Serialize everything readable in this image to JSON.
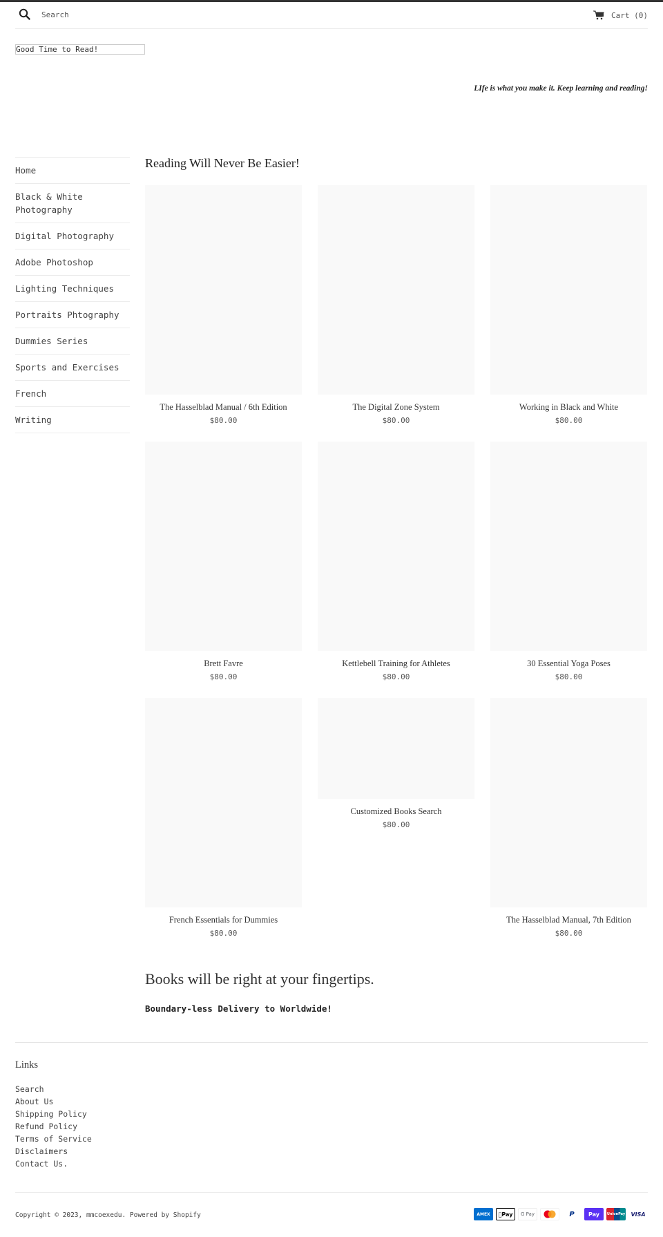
{
  "header": {
    "search_placeholder": "Search",
    "cart_label": "Cart (0)"
  },
  "site_title": "Good Time to Read!",
  "tagline": "LIfe is what you make it. Keep learning and reading!",
  "sidebar": {
    "items": [
      {
        "label": "Home"
      },
      {
        "label": "Black & White Photography"
      },
      {
        "label": "Digital Photography"
      },
      {
        "label": "Adobe Photoshop"
      },
      {
        "label": "Lighting Techniques"
      },
      {
        "label": "Portraits Phtography"
      },
      {
        "label": "Dummies Series"
      },
      {
        "label": "Sports and Exercises"
      },
      {
        "label": "French"
      },
      {
        "label": "Writing"
      }
    ]
  },
  "main": {
    "title": "Reading Will Never Be Easier!",
    "products": [
      {
        "title": "The Hasselblad Manual / 6th Edition",
        "price": "$80.00"
      },
      {
        "title": "The Digital Zone System",
        "price": "$80.00"
      },
      {
        "title": "Working in Black and White",
        "price": "$80.00"
      },
      {
        "title": "Brett Favre",
        "price": "$80.00"
      },
      {
        "title": "Kettlebell Training for Athletes",
        "price": "$80.00"
      },
      {
        "title": "30 Essential Yoga Poses",
        "price": "$80.00"
      },
      {
        "title": "French Essentials for Dummies",
        "price": "$80.00"
      },
      {
        "title": "Customized Books Search",
        "price": "$80.00"
      },
      {
        "title": "The Hasselblad Manual, 7th Edition",
        "price": "$80.00"
      }
    ]
  },
  "promo": {
    "heading": "Books will be right at your fingertips.",
    "subtext": "Boundary-less Delivery to Worldwide!"
  },
  "footer": {
    "heading": "Links",
    "links": [
      {
        "label": "Search"
      },
      {
        "label": "About Us"
      },
      {
        "label": "Shipping Policy"
      },
      {
        "label": "Refund Policy"
      },
      {
        "label": "Terms of Service"
      },
      {
        "label": "Disclaimers"
      },
      {
        "label": "Contact Us."
      }
    ],
    "copyright_prefix": "Copyright © 2023, ",
    "store_name": "mmcoexedu",
    "powered_by": ". Powered by Shopify",
    "payment_methods": [
      {
        "name": "American Express",
        "label": "AMEX",
        "bg": "#016fd0",
        "fg": "#ffffff"
      },
      {
        "name": "Apple Pay",
        "label": "Pay",
        "bg": "#ffffff",
        "fg": "#000000"
      },
      {
        "name": "Google Pay",
        "label": "G Pay",
        "bg": "#ffffff",
        "fg": "#5f6368"
      },
      {
        "name": "Mastercard",
        "label": "",
        "bg": "#ffffff",
        "fg": "#eb001b"
      },
      {
        "name": "PayPal",
        "label": "P",
        "bg": "#ffffff",
        "fg": "#003087"
      },
      {
        "name": "Shop Pay",
        "label": "Pay",
        "bg": "#5a31f4",
        "fg": "#ffffff"
      },
      {
        "name": "Union Pay",
        "label": "UnionPay",
        "bg": "#d9232e",
        "fg": "#ffffff"
      },
      {
        "name": "Visa",
        "label": "VISA",
        "bg": "#ffffff",
        "fg": "#1a1f71"
      }
    ]
  }
}
